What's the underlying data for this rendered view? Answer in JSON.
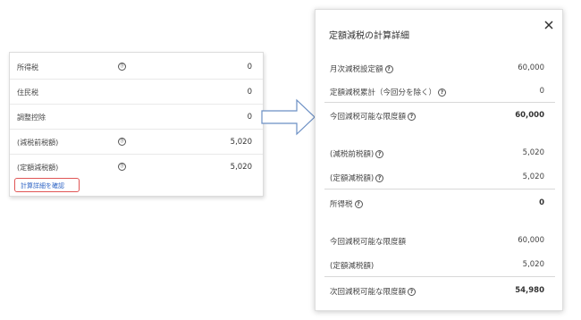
{
  "left": {
    "rows": [
      {
        "label": "所得税",
        "icon": "㊦",
        "value": "0"
      },
      {
        "label": "住民税",
        "icon": "",
        "value": "0"
      },
      {
        "label": "調整控除",
        "icon": "",
        "value": "0"
      },
      {
        "label": "(減税前税額)",
        "icon": "㊦",
        "value": "5,020"
      },
      {
        "label": "(定額減税額)",
        "icon": "㊦",
        "value": "5,020"
      }
    ],
    "link": "計算詳細を確認"
  },
  "modal": {
    "title": "定額減税の計算詳細",
    "close": "×",
    "help_glyph": "?",
    "rows": [
      {
        "label": "月次減税設定額",
        "value": "60,000"
      },
      {
        "label": "定額減税累計（今回分を除く）",
        "value": "0"
      },
      {
        "label": "今回減税可能な限度額",
        "value": "60,000"
      },
      {
        "label": "(減税前税額)",
        "value": "5,020"
      },
      {
        "label": "(定額減税額)",
        "value": "5,020"
      },
      {
        "label": "所得税",
        "value": "0"
      },
      {
        "label": "今回減税可能な限度額",
        "value": "60,000"
      },
      {
        "label": "(定額減税額)",
        "value": "5,020"
      },
      {
        "label": "次回減税可能な限度額",
        "value": "54,980"
      }
    ]
  }
}
